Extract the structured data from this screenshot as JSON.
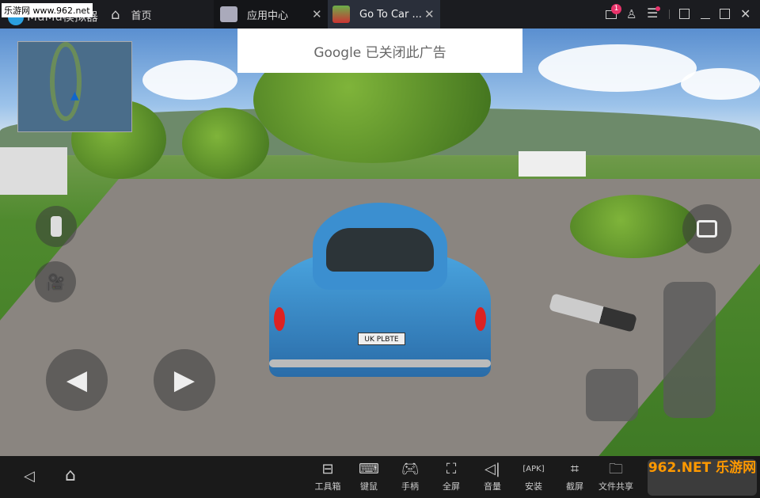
{
  "titlebar": {
    "watermark": "乐游网 www.962.net",
    "app_name": "MuMu模拟器",
    "tabs": [
      {
        "label": "首页",
        "icon": "home-icon"
      },
      {
        "label": "应用中心",
        "icon": "app-store-icon"
      },
      {
        "label": "Go To Car ...",
        "icon": "game-icon",
        "active": true
      }
    ],
    "mail_badge": "1",
    "close_glyph": "✕"
  },
  "ad": {
    "text": "Google 已关闭此广告"
  },
  "game": {
    "license_plate": "UK PLBTE"
  },
  "toolbar": {
    "items": [
      {
        "label": "工具箱",
        "icon": "toolbox-icon"
      },
      {
        "label": "键鼠",
        "icon": "keyboard-icon"
      },
      {
        "label": "手柄",
        "icon": "gamepad-icon"
      },
      {
        "label": "全屏",
        "icon": "fullscreen-icon"
      },
      {
        "label": "音量",
        "icon": "volume-icon"
      },
      {
        "label": "安装",
        "icon": "apk-install-icon"
      },
      {
        "label": "截屏",
        "icon": "crop-icon"
      },
      {
        "label": "文件共享",
        "icon": "folder-icon"
      }
    ]
  },
  "logo_watermark": "962.NET 乐游网",
  "colors": {
    "titlebar": "#1b1c20",
    "active_tab": "#2a2f3a",
    "badge": "#e8336a",
    "toolbar": "#1a1a1a"
  }
}
